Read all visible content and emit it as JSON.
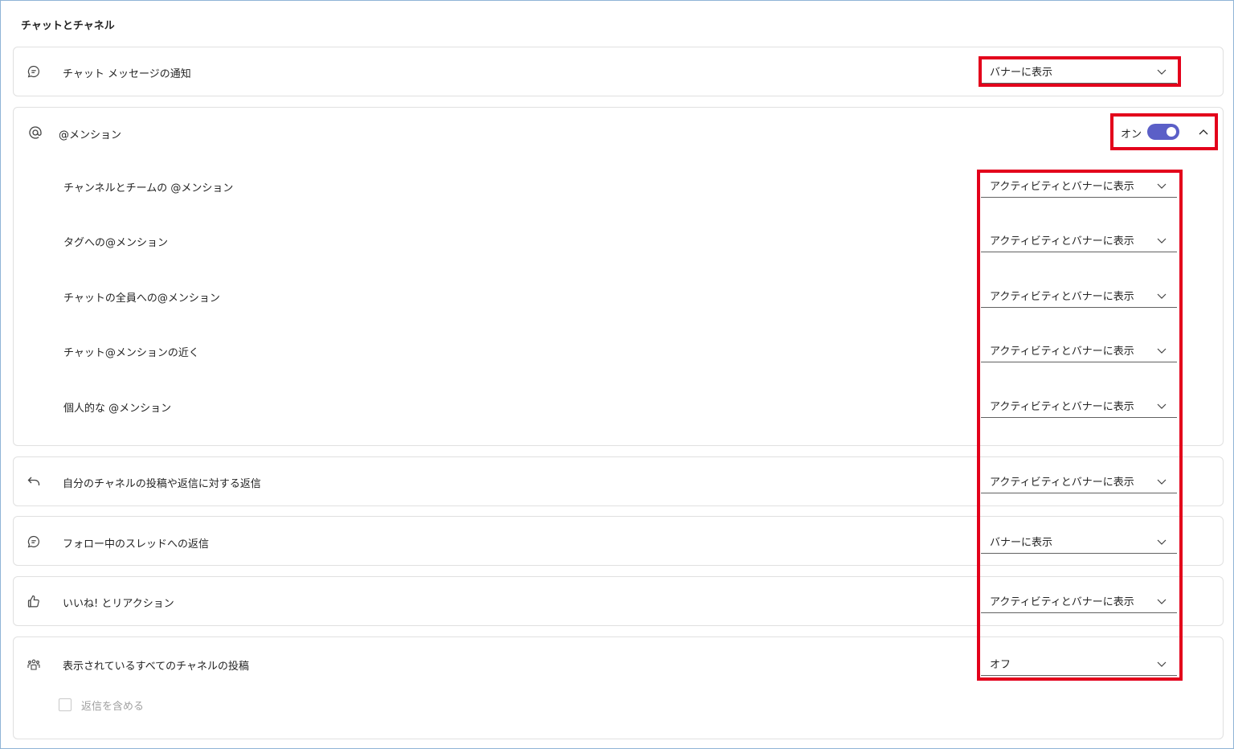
{
  "section_title": "チャットとチャネル",
  "chat_message": {
    "label": "チャット メッセージの通知",
    "icon": "chat-icon",
    "value": "バナーに表示"
  },
  "mentions": {
    "label": "@メンション",
    "icon": "at-icon",
    "toggle_label": "オン",
    "toggle_on": true,
    "items": [
      {
        "label": "チャンネルとチームの @メンション",
        "value": "アクティビティとバナーに表示"
      },
      {
        "label": "タグへの@メンション",
        "value": "アクティビティとバナーに表示"
      },
      {
        "label": "チャットの全員への@メンション",
        "value": "アクティビティとバナーに表示"
      },
      {
        "label": "チャット@メンションの近く",
        "value": "アクティビティとバナーに表示"
      },
      {
        "label": "個人的な @メンション",
        "value": "アクティビティとバナーに表示"
      }
    ]
  },
  "replies_own": {
    "label": "自分のチャネルの投稿や返信に対する返信",
    "icon": "reply-icon",
    "value": "アクティビティとバナーに表示"
  },
  "followed_threads": {
    "label": "フォロー中のスレッドへの返信",
    "icon": "chat-icon",
    "value": "バナーに表示"
  },
  "likes": {
    "label": "いいね! とリアクション",
    "icon": "thumbs-up-icon",
    "value": "アクティビティとバナーに表示"
  },
  "all_channel_posts": {
    "label": "表示されているすべてのチャネルの投稿",
    "icon": "people-team-icon",
    "value": "オフ",
    "include_replies_label": "返信を含める",
    "include_replies_checked": false
  },
  "colors": {
    "toggle_on": "#5b5fc7",
    "highlight": "#e3001b"
  }
}
